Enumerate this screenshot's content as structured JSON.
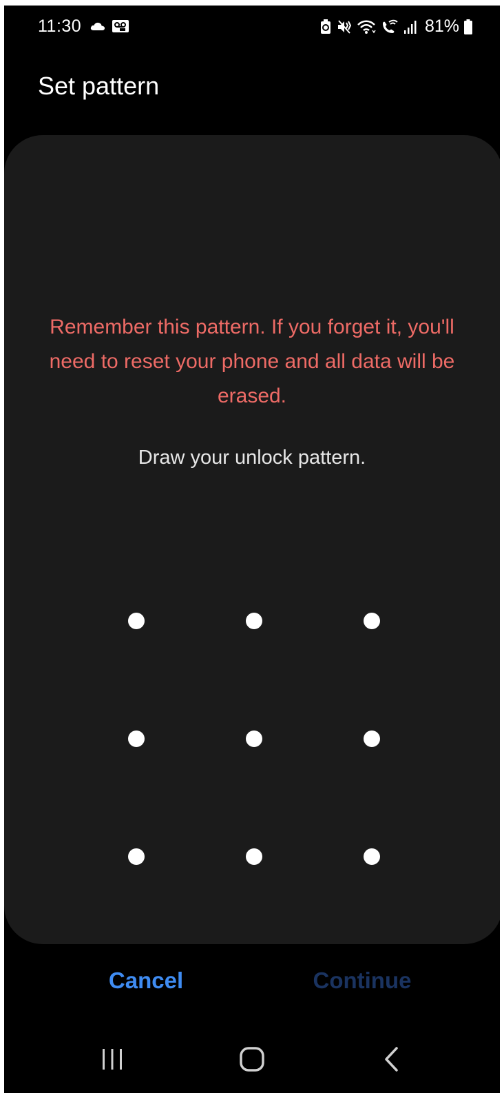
{
  "status_bar": {
    "time": "11:30",
    "battery_text": "81%",
    "left_icons": [
      "cloud-icon",
      "voicemail-icon"
    ],
    "right_icons": [
      "battery-saver-icon",
      "mute-icon",
      "wifi-icon",
      "wifi-calling-icon",
      "signal-icon",
      "battery-icon"
    ]
  },
  "header": {
    "title": "Set pattern"
  },
  "card": {
    "warning": "Remember this pattern. If you forget it, you'll need to reset your phone and all data will be erased.",
    "instruction": "Draw your unlock pattern.",
    "pattern_rows": 3,
    "pattern_cols": 3
  },
  "buttons": {
    "cancel_label": "Cancel",
    "continue_label": "Continue",
    "continue_enabled": false
  },
  "nav": {
    "recents": "recents-icon",
    "home": "home-icon",
    "back": "back-icon"
  },
  "colors": {
    "background": "#000000",
    "card": "#1b1b1b",
    "warning": "#ee6b66",
    "accent": "#3f8cf2",
    "disabled_accent": "#1a3360"
  }
}
